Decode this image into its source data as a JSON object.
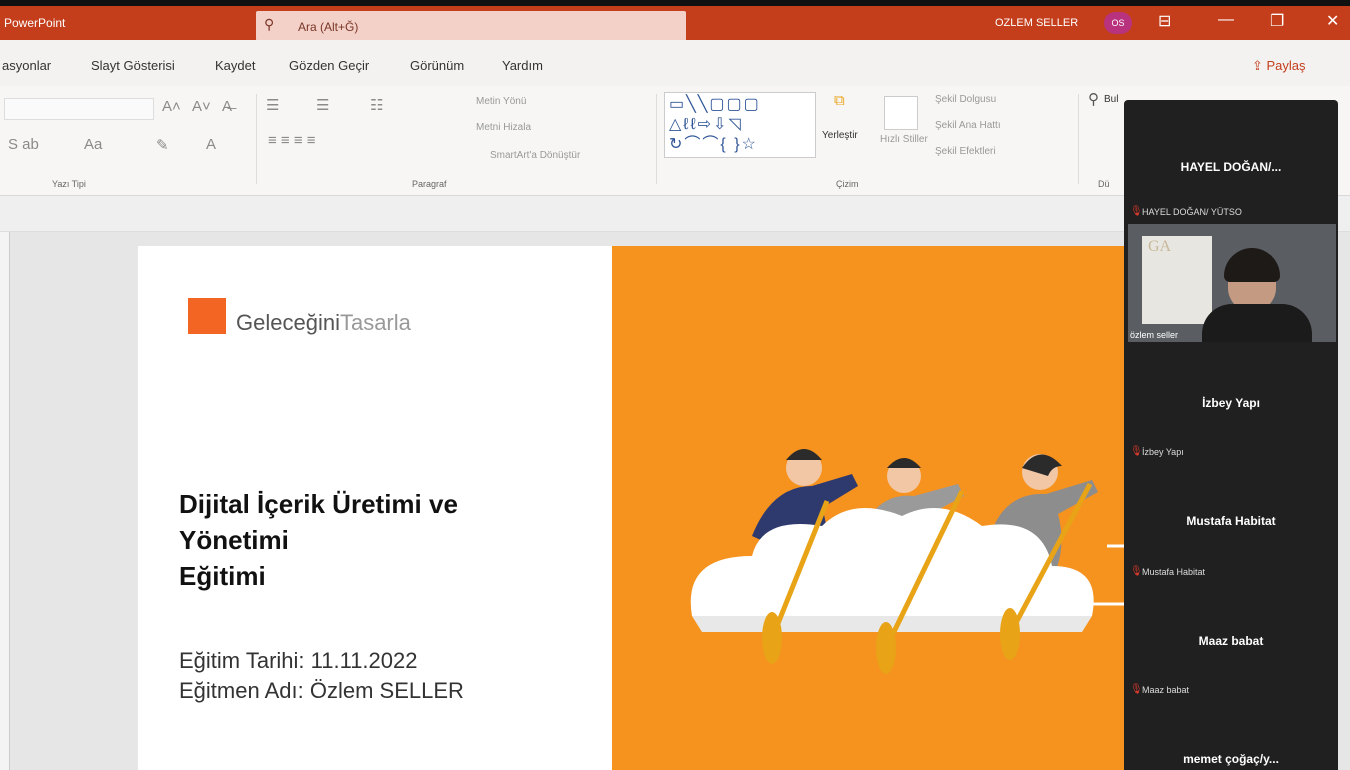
{
  "titlebar": {
    "app": "PowerPoint",
    "search_placeholder": "Ara (Alt+Ğ)",
    "user_name": "OZLEM SELLER",
    "user_initials": "OS"
  },
  "menu": {
    "tabs": [
      "asyonlar",
      "Slayt Gösterisi",
      "Kaydet",
      "Gözden Geçir",
      "Görünüm",
      "Yardım"
    ],
    "share": "Paylaş"
  },
  "ribbon": {
    "groups": [
      "Yazı Tipi",
      "Paragraf",
      "Çizim",
      "Dü"
    ],
    "items": {
      "metin_yonu": "Metin Yönü",
      "metin_hizala": "Metni Hizala",
      "smartart": "SmartArt'a Dönüştür",
      "yerlestir": "Yerleştir",
      "hizli_stiller": "Hızlı Stiller",
      "sekil_dolgusu": "Şekil Dolgusu",
      "sekil_ana_hatti": "Şekil Ana Hattı",
      "sekil_efektleri": "Şekil Efektleri",
      "bul": "Bul"
    }
  },
  "slide": {
    "logo_part1": "Geleceğini",
    "logo_part2": "Tasarla",
    "title_line1": "Dijital İçerik Üretimi ve",
    "title_line2": "Yönetimi",
    "title_line3": "Eğitimi",
    "info_line1": "Eğitim Tarihi: 11.11.2022",
    "info_line2": "Eğitmen Adı: Özlem SELLER"
  },
  "participants": {
    "p1_header": "HAYEL DOĞAN/...",
    "p1_small": "HAYEL DOĞAN/ YÜTSO",
    "video_label": "özlem seller",
    "p2_header": "İzbey Yapı",
    "p2_small": "İzbey Yapı",
    "p3_header": "Mustafa Habitat",
    "p3_small": "Mustafa Habitat",
    "p4_header": "Maaz babat",
    "p4_small": "Maaz babat",
    "p5_header": "memet çoğaç/y..."
  }
}
